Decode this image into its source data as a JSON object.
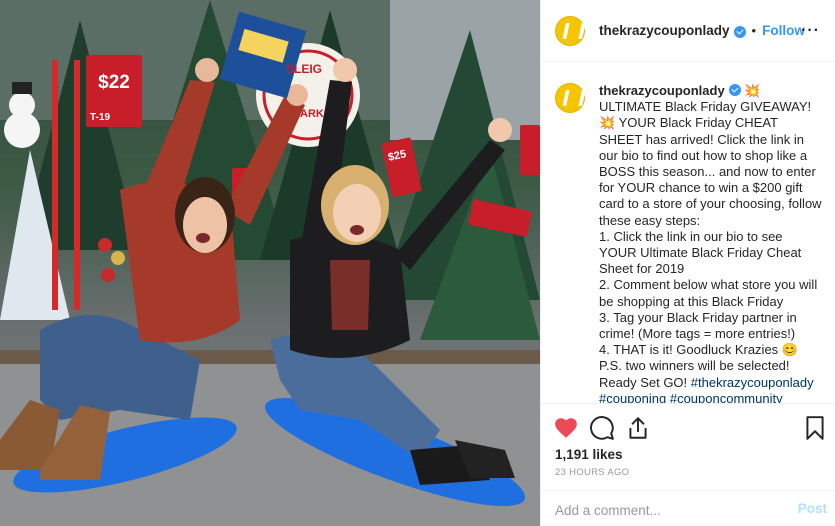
{
  "post": {
    "username": "thekrazycouponlady",
    "separator": "•",
    "follow_label": "Follow",
    "more_label": "···",
    "caption_user": "thekrazycouponlady",
    "caption_text": " 💥ULTIMATE Black Friday GIVEAWAY!💥 YOUR Black Friday CHEAT SHEET has arrived! Click the link in our bio to find out how to shop like a BOSS this season... and now to enter for YOUR chance to win a $200 gift card to a store of your choosing, follow these easy steps:\n1. Click the link in our bio to see YOUR Ultimate Black Friday Cheat Sheet for 2019\n2. Comment below what store you will be shopping at this Black Friday\n3. Tag your Black Friday partner in crime! (More tags = more entries!)\n4. THAT is it! Goodluck Krazies 😊\nP.S. two winners will be selected!\nReady Set GO! ",
    "caption_tags": "#thekrazycouponlady #couponing #couponcommunity #coupons #extremecouponing",
    "likes": "1,191 likes",
    "time_ago": "23 HOURS AGO",
    "comment_placeholder": "Add a comment...",
    "post_label": "Post"
  },
  "photo": {
    "price_tag_1": "$22",
    "price_tag_1_code": "T-19",
    "price_tag_2": "$25",
    "sign_text": "SLEIG",
    "sign_text_2": "ARK"
  },
  "colors": {
    "accent": "#3897f0",
    "like_red": "#ed4956",
    "brand_yellow": "#f7c400",
    "sled_blue": "#1f6fe0"
  },
  "icons": {
    "like": "heart-icon",
    "comment": "comment-icon",
    "share": "share-icon",
    "save": "bookmark-icon",
    "verified": "verified-badge-icon"
  }
}
